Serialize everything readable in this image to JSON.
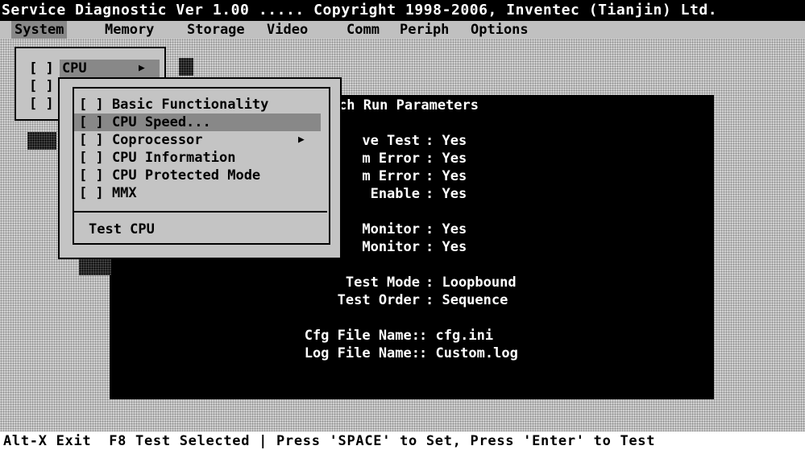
{
  "title": "Service Diagnostic Ver 1.00 ..... Copyright 1998-2006, Inventec (Tianjin) Ltd.",
  "menubar": {
    "items": [
      "System",
      "Memory",
      "Storage",
      "Video",
      "Comm",
      "Periph",
      "Options"
    ]
  },
  "system_menu": {
    "item_cpu": "[ ] CPU",
    "item_2": "[ ]",
    "item_3": "[ ]",
    "arrow": "▶"
  },
  "cpu_submenu": {
    "items": [
      "[ ] Basic Functionality",
      "[ ] CPU Speed...",
      "[ ] Coprocessor",
      "[ ] CPU Information",
      "[ ] CPU Protected Mode",
      "[ ] MMX"
    ],
    "coprocessor_arrow": "▶",
    "test_label": "Test CPU"
  },
  "params": {
    "heading": "ch Run Parameters",
    "rows": [
      {
        "label": "ve Test",
        "value": ": Yes"
      },
      {
        "label": "m Error",
        "value": ": Yes"
      },
      {
        "label": "m Error",
        "value": ": Yes"
      },
      {
        "label": "Enable",
        "value": ": Yes"
      },
      {
        "label": "Monitor",
        "value": ": Yes"
      },
      {
        "label": "Monitor",
        "value": ": Yes"
      },
      {
        "label": "Test Mode",
        "value": ": Loopbound"
      },
      {
        "label": "Test Order",
        "value": ": Sequence"
      },
      {
        "label": "Cfg File Name:",
        "value": ": cfg.ini"
      },
      {
        "label": "Log File Name:",
        "value": ": Custom.log"
      }
    ]
  },
  "status_bar": "Alt-X Exit  F8 Test Selected | Press 'SPACE' to Set, Press 'Enter' to Test"
}
